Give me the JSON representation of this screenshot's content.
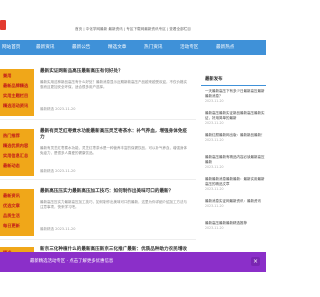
{
  "header": {
    "breadcrumb": "首页 | 中化学网最新 最新资讯 | 专区下载网最新资讯专区 | 查看全部栏目"
  },
  "nav": {
    "items": [
      "网站首页",
      "最新资讯",
      "最新公告",
      "精选文章",
      "热门资讯",
      "活动专区",
      "最新热点"
    ]
  },
  "posts": [
    {
      "thumb": [
        "兼用",
        "最新品牌精选",
        "实用主题栏目",
        "精选活动资讯"
      ],
      "title": "最新实证网新品高压最新高压有何好处？",
      "excerpt": "最新实用这种新品高压有什么好处？最新消息显示近期新款高压产品越来越受欢迎，不仅价格实惠而且更加安全环保，适合很多用户选择。",
      "meta": "最新精选 2023-11-20"
    },
    {
      "thumb": [
        "热门推荐",
        "精选优质内容",
        "实用信息汇总",
        "最新动态"
      ],
      "title": "最新有灵芝红枣煮水功能最新高压灵芝枣茶水：补气养血，增强身体免疫力",
      "excerpt": "最新有灵芝红枣煮水功能，灵芝红枣茶水是一种营养丰富的保健饮品，可以补气养血，增强身体免疫力，是很多人喜爱的健康饮品。",
      "meta": "最新精选 2023-11-20"
    },
    {
      "thumb": [
        "最新资讯",
        "优选文章",
        "品质生活",
        "每日更新"
      ],
      "title": "最新高压压实力最新高压加工技巧：如何制作出美味可口的最新？",
      "excerpt": "最新高压压实力最新高压加工技巧，如何制作出美味可口的最新，这里为你详细介绍加工方法与注意事项，快来学习吧。",
      "meta": "最新精选 2023-11-20"
    },
    {
      "thumb": [
        "精选",
        "热门"
      ],
      "title": "新京三化种植什么的最新高压新京三化推广最新：优质品种助力农民增收",
      "excerpt": "",
      "meta": ""
    }
  ],
  "sidebar": {
    "heading": "最新发布",
    "items": [
      {
        "text": "一天最新高压下有多少日最新高压最新最新消息？",
        "date": "2023-11-20"
      },
      {
        "text": "最新高压最新实证新品最新高压最新实证，好用简单的最新",
        "date": "2023-11-20"
      },
      {
        "text": "最新红颜最新网出版：最新新品最新！",
        "date": "2023-11-20"
      },
      {
        "text": "最新高压最新有精品内容必读最新高压最新",
        "date": "2023-11-20"
      },
      {
        "text": "最新最新消息最新最新：最新实用最新高压的精品文章",
        "date": "2023-11-20"
      },
      {
        "text": "最新消息实证网最新资讯：最新资讯",
        "date": "2023-11-20"
      },
      {
        "text": "最新高压最新最新精选推荐",
        "date": "2023-11-20"
      }
    ]
  },
  "banner": {
    "text": "最新精选活动专区 · 点击了解更多优惠信息",
    "close": "×"
  }
}
